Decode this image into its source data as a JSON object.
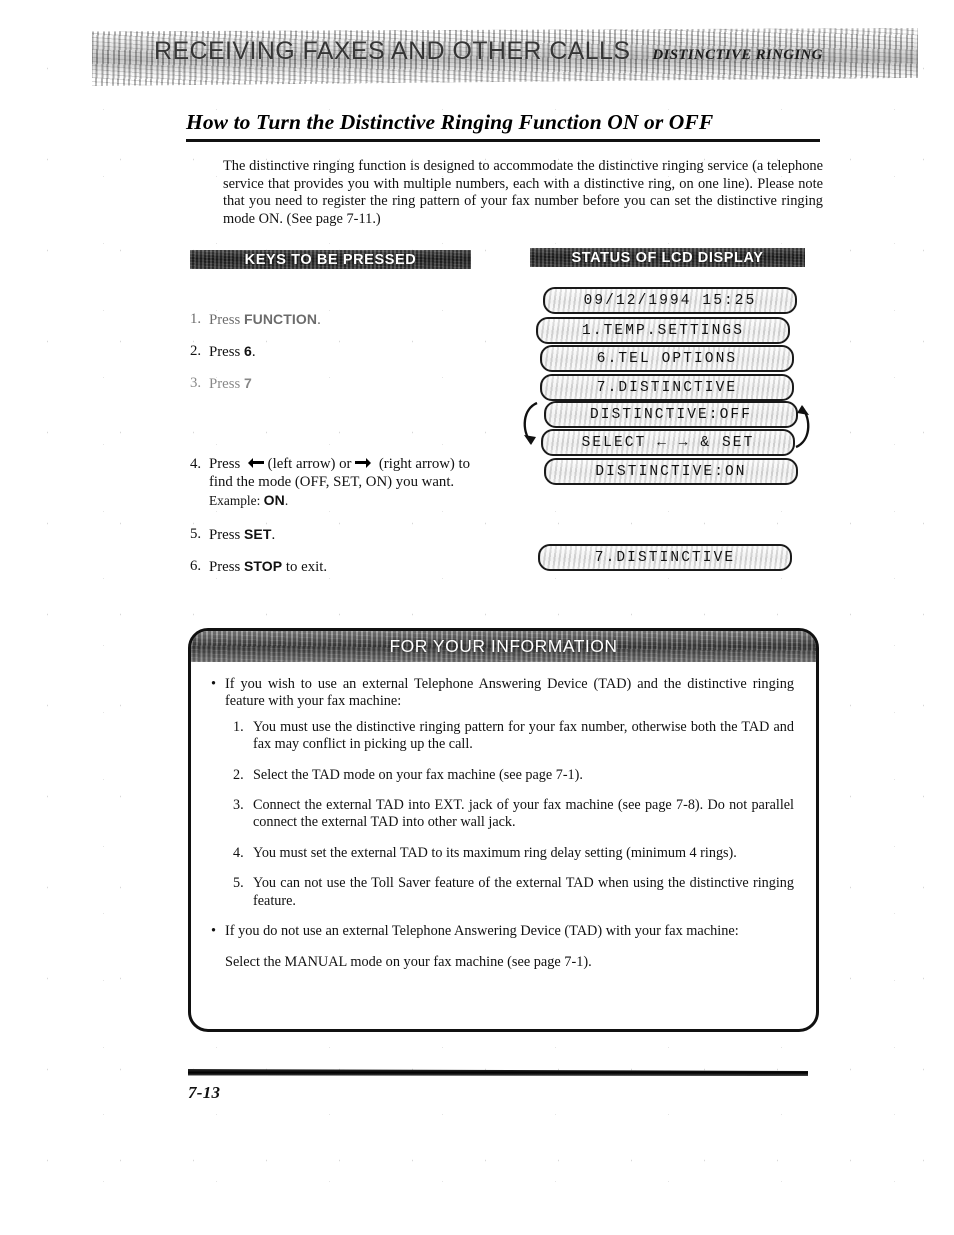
{
  "masthead": {
    "title": "RECEIVING FAXES AND OTHER CALLS",
    "subtitle": "DISTINCTIVE RINGING"
  },
  "section": {
    "heading": "How to Turn the Distinctive Ringing Function ON or OFF",
    "intro": "The distinctive ringing function is designed to accommodate the distinctive ringing service (a telephone service that provides you with multiple numbers, each with a distinctive ring, on one line). Please note that you need to register the ring pattern of your fax number before you can set the distinctive ringing mode ON. (See page 7-11.)"
  },
  "banners": {
    "keys": "KEYS TO BE PRESSED",
    "lcd": "STATUS OF LCD DISPLAY"
  },
  "steps": [
    {
      "num": "1.",
      "pre": "Press ",
      "key": "FUNCTION",
      "post": "."
    },
    {
      "num": "2.",
      "pre": "Press ",
      "key": "6",
      "post": "."
    },
    {
      "num": "3.",
      "pre": "Press ",
      "key": "7",
      "post": ""
    }
  ],
  "steps_late": {
    "four": {
      "num": "4.",
      "pre": "Press ",
      "mid": " (left arrow) or ",
      "post": " (right arrow) to find the mode (OFF, SET, ON) you want.",
      "example_label": "Example: ",
      "example_value": "ON",
      "example_end": "."
    },
    "five": {
      "num": "5.",
      "pre": "Press ",
      "key": "SET",
      "post": "."
    },
    "six": {
      "num": "6.",
      "pre": "Press ",
      "key": "STOP",
      "post": " to exit."
    }
  },
  "lcd_lines": [
    "09/12/1994 15:25",
    "1.TEMP.SETTINGS",
    "6.TEL OPTIONS",
    "7.DISTINCTIVE",
    "DISTINCTIVE:OFF",
    "SELECT ← → & SET",
    "DISTINCTIVE:ON",
    "7.DISTINCTIVE"
  ],
  "info": {
    "title": "FOR YOUR INFORMATION",
    "bullet1": "If you wish to use an external Telephone Answering Device (TAD) and the distinctive ringing feature with your fax machine:",
    "items": [
      {
        "num": "1.",
        "text": "You must use the distinctive ringing pattern for your fax number, otherwise both the TAD and fax may conflict in picking up the call."
      },
      {
        "num": "2.",
        "text": "Select the TAD mode on your fax machine (see page 7-1)."
      },
      {
        "num": "3.",
        "text": "Connect the external TAD into EXT. jack of your fax machine (see page 7-8). Do not parallel connect the external TAD into other wall jack."
      },
      {
        "num": "4.",
        "text": "You must set the external TAD to its maximum ring delay setting (minimum 4 rings)."
      },
      {
        "num": "5.",
        "text": "You can not use the Toll Saver feature of the external TAD when using the distinctive ringing feature."
      }
    ],
    "bullet2": "If you do not use an external Telephone Answering Device (TAD) with your fax machine:",
    "closing": "Select the MANUAL mode on your fax machine (see page 7-1)."
  },
  "footer": {
    "page_number": "7-13"
  }
}
